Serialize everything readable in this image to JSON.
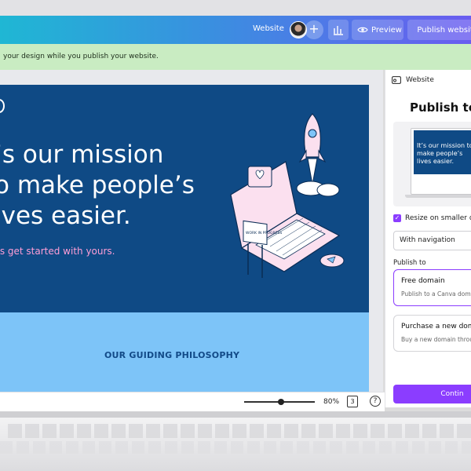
{
  "header": {
    "website_label": "Website",
    "preview_label": "Preview",
    "publish_label": "Publish website"
  },
  "banner": {
    "text": "your design while you publish your website."
  },
  "design": {
    "headline_lines": [
      "’s our mission",
      "o make people’s",
      "ives easier."
    ],
    "subline": "’s get started with yours.",
    "section_title": "OUR GUIDING PHILOSOPHY",
    "sign_text": "WORK IN PROGRESS"
  },
  "panel": {
    "header_label": "Website",
    "title": "Publish to t",
    "thumb_text": "It’s our mission to make people’s lives easier.",
    "resize_label": "Resize on smaller dev",
    "navigation_select": "With navigation",
    "publish_to_label": "Publish to",
    "options": [
      {
        "title": "Free domain",
        "desc": "Publish to a Canva domai"
      },
      {
        "title": "Purchase a new doma",
        "desc": "Buy a new domain throug"
      }
    ],
    "continue_label": "Contin"
  },
  "toolbar": {
    "zoom": "80%",
    "zoom_fraction": 0.5,
    "pages": "3",
    "help": "?"
  },
  "colors": {
    "accent": "#8b3dff",
    "page_blue": "#0f4a85",
    "light_blue": "#7dc4f8",
    "pink": "#ff9ed6",
    "banner_green": "#c9ecc2"
  }
}
